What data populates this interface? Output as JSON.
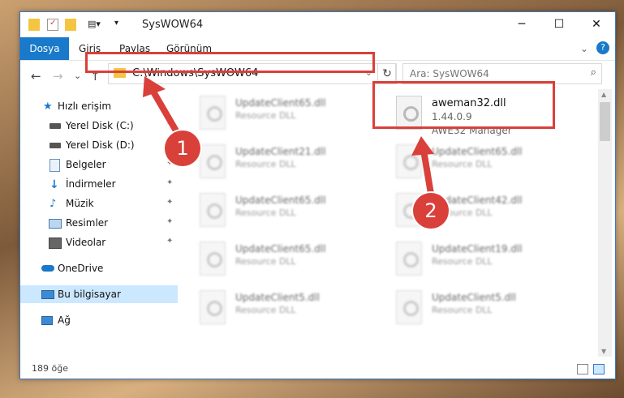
{
  "window": {
    "title": "SysWOW64",
    "minimize_icon": "─",
    "maximize_icon": "☐",
    "close_icon": "✕"
  },
  "ribbon": {
    "tabs": [
      "Dosya",
      "Giriş",
      "Paylaş",
      "Görünüm"
    ],
    "active_tab": "Dosya",
    "help_icon": "?",
    "expand_icon": "⌄"
  },
  "nav": {
    "back_icon": "←",
    "forward_icon": "→",
    "recent_icon": "⌄",
    "up_icon": "↑",
    "address": "C:\\Windows\\SysWOW64",
    "address_dropdown_icon": "⌄",
    "refresh_icon": "↻",
    "search_placeholder": "Ara: SysWOW64",
    "search_icon": "⌕"
  },
  "sidebar": {
    "items": [
      {
        "label": "Hızlı erişim",
        "icon": "star-icon",
        "pinned": false
      },
      {
        "label": "Yerel Disk (C:)",
        "icon": "disk-icon",
        "pinned": true
      },
      {
        "label": "Yerel Disk (D:)",
        "icon": "disk-icon",
        "pinned": true
      },
      {
        "label": "Belgeler",
        "icon": "documents-icon",
        "pinned": true
      },
      {
        "label": "İndirmeler",
        "icon": "download-icon",
        "pinned": true
      },
      {
        "label": "Müzik",
        "icon": "music-icon",
        "pinned": true
      },
      {
        "label": "Resimler",
        "icon": "pictures-icon",
        "pinned": true
      },
      {
        "label": "Videolar",
        "icon": "video-icon",
        "pinned": true
      },
      {
        "label": "OneDrive",
        "icon": "cloud-icon",
        "pinned": false
      },
      {
        "label": "Bu bilgisayar",
        "icon": "computer-icon",
        "pinned": false,
        "selected": true
      },
      {
        "label": "Ağ",
        "icon": "network-icon",
        "pinned": false
      }
    ],
    "pin_glyph": "📌"
  },
  "files": {
    "featured": {
      "name": "aweman32.dll",
      "version": "1.44.0.9",
      "description": "AWE32 Manager"
    },
    "blurred": [
      {
        "name": "UpdateClient65.dll",
        "type": "Resource DLL"
      },
      {
        "name": "UpdateClient21.dll",
        "type": "Resource DLL"
      },
      {
        "name": "UpdateClient65.dll",
        "type": "Resource DLL"
      },
      {
        "name": "UpdateClient65.dll",
        "type": "Resource DLL"
      },
      {
        "name": "UpdateClient5.dll",
        "type": "Resource DLL"
      },
      {
        "name": "UpdateClient65.dll",
        "type": "Resource DLL"
      },
      {
        "name": "UpdateClient42.dll",
        "type": "Resource DLL"
      },
      {
        "name": "UpdateClient19.dll",
        "type": "Resource DLL"
      },
      {
        "name": "UpdateClient5.dll",
        "type": "Resource DLL"
      }
    ]
  },
  "status": {
    "item_count": "189 öğe"
  },
  "annotations": {
    "step1": "1",
    "step2": "2",
    "color": "#d9403a"
  },
  "colors": {
    "accent": "#1979ca",
    "selection": "#cce8ff",
    "highlight": "#d9403a"
  }
}
